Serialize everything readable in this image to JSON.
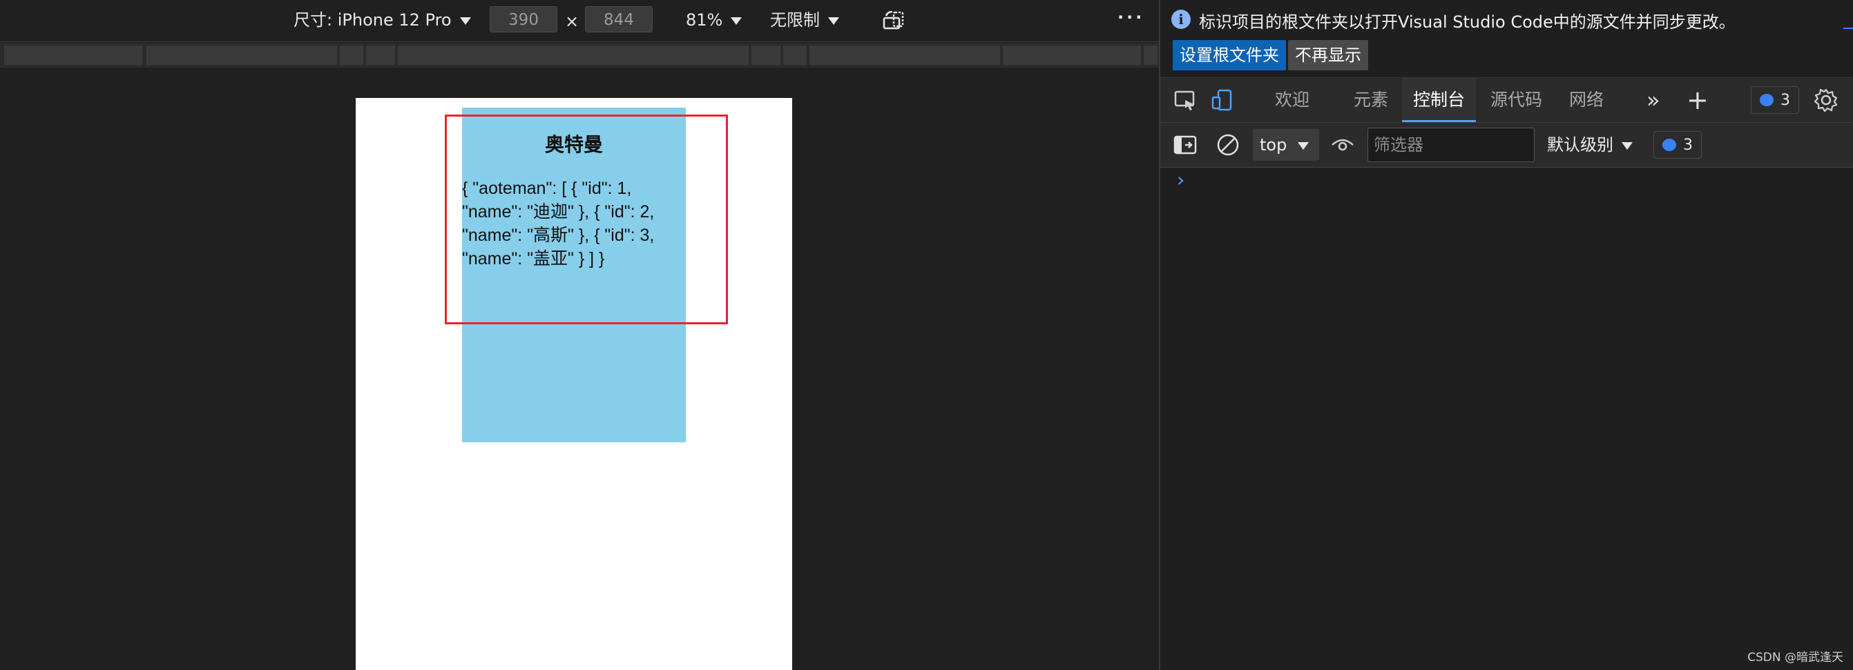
{
  "device_toolbar": {
    "device_label": "尺寸: iPhone 12 Pro",
    "width_value": "390",
    "times_sign": "×",
    "height_value": "844",
    "zoom": "81%",
    "throttling": "无限制",
    "more_label": "···"
  },
  "page": {
    "title": "奥特曼",
    "json_text": "{ \"aoteman\": [ { \"id\": 1, \"name\": \"迪迦\" }, { \"id\": 2, \"name\": \"高斯\" }, { \"id\": 3, \"name\": \"盖亚\" } ] }"
  },
  "infobar": {
    "message": "标识项目的根文件夹以打开Visual Studio Code中的源文件并同步更改。",
    "set_root_label": "设置根文件夹",
    "dont_show_label": "不再显示"
  },
  "tabs": [
    {
      "label": "欢迎",
      "active": false
    },
    {
      "label": "元素",
      "active": false
    },
    {
      "label": "控制台",
      "active": true
    },
    {
      "label": "源代码",
      "active": false
    },
    {
      "label": "网络",
      "active": false
    }
  ],
  "tabbar": {
    "more_tabs_label": "»",
    "add_tab_label": "+",
    "issues_count": "3"
  },
  "console_toolbar": {
    "context": "top",
    "filter_placeholder": "筛选器",
    "level": "默认级别",
    "issues_count": "3"
  },
  "console": {
    "prompt": "›"
  },
  "watermark": "CSDN @暗武逢天",
  "colors": {
    "accent": "#4da3ff",
    "primary_button": "#0e63b5",
    "page_box": "#87ceeb",
    "highlight": "#e8252a"
  }
}
